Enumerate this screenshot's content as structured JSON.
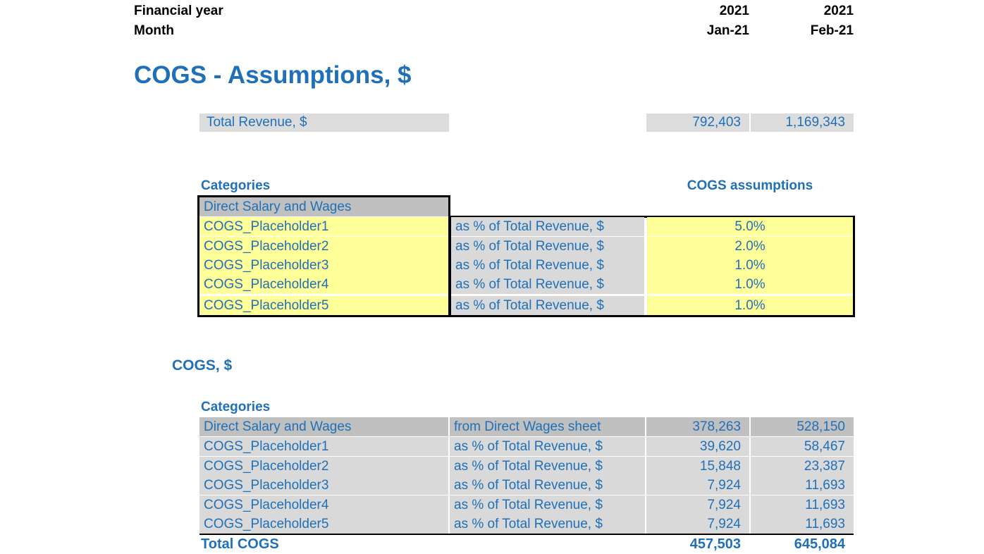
{
  "header": {
    "financial_year_label": "Financial year",
    "month_label": "Month",
    "year_col1": "2021",
    "year_col2": "2021",
    "month_col1": "Jan-21",
    "month_col2": "Feb-21"
  },
  "titles": {
    "main": "COGS - Assumptions, $",
    "sub": "COGS, $"
  },
  "colors": {
    "accent_blue": "#1f70b8",
    "input_yellow": "#ffff99",
    "header_gray": "#c0c0c0",
    "cell_gray": "#d9d9d9"
  },
  "total_revenue": {
    "label": "Total Revenue, $",
    "values": [
      "792,403",
      "1,169,343"
    ]
  },
  "assumptions_table": {
    "header_categories": "Categories",
    "header_values": "COGS assumptions",
    "rows": [
      {
        "name": "Direct Salary and Wages",
        "desc": "",
        "pct": "",
        "style": "gray"
      },
      {
        "name": "COGS_Placeholder1",
        "desc": "as % of Total Revenue, $",
        "pct": "5.0%",
        "style": "yellow"
      },
      {
        "name": "COGS_Placeholder2",
        "desc": "as % of Total Revenue, $",
        "pct": "2.0%",
        "style": "yellow"
      },
      {
        "name": "COGS_Placeholder3",
        "desc": "as % of Total Revenue, $",
        "pct": "1.0%",
        "style": "yellow"
      },
      {
        "name": "COGS_Placeholder4",
        "desc": "as % of Total Revenue, $",
        "pct": "1.0%",
        "style": "yellow"
      },
      {
        "name": "COGS_Placeholder5",
        "desc": "as % of Total Revenue, $",
        "pct": "1.0%",
        "style": "yellow"
      }
    ]
  },
  "cogs_table": {
    "header_categories": "Categories",
    "rows": [
      {
        "name": "Direct Salary and Wages",
        "desc": "from Direct Wages sheet",
        "v1": "378,263",
        "v2": "528,150",
        "style": "dark"
      },
      {
        "name": "COGS_Placeholder1",
        "desc": "as % of Total Revenue, $",
        "v1": "39,620",
        "v2": "58,467",
        "style": "light"
      },
      {
        "name": "COGS_Placeholder2",
        "desc": "as % of Total Revenue, $",
        "v1": "15,848",
        "v2": "23,387",
        "style": "light"
      },
      {
        "name": "COGS_Placeholder3",
        "desc": "as % of Total Revenue, $",
        "v1": "7,924",
        "v2": "11,693",
        "style": "light"
      },
      {
        "name": "COGS_Placeholder4",
        "desc": "as % of Total Revenue, $",
        "v1": "7,924",
        "v2": "11,693",
        "style": "light"
      },
      {
        "name": "COGS_Placeholder5",
        "desc": "as % of Total Revenue, $",
        "v1": "7,924",
        "v2": "11,693",
        "style": "light"
      }
    ],
    "total": {
      "label": "Total COGS",
      "v1": "457,503",
      "v2": "645,084"
    }
  }
}
